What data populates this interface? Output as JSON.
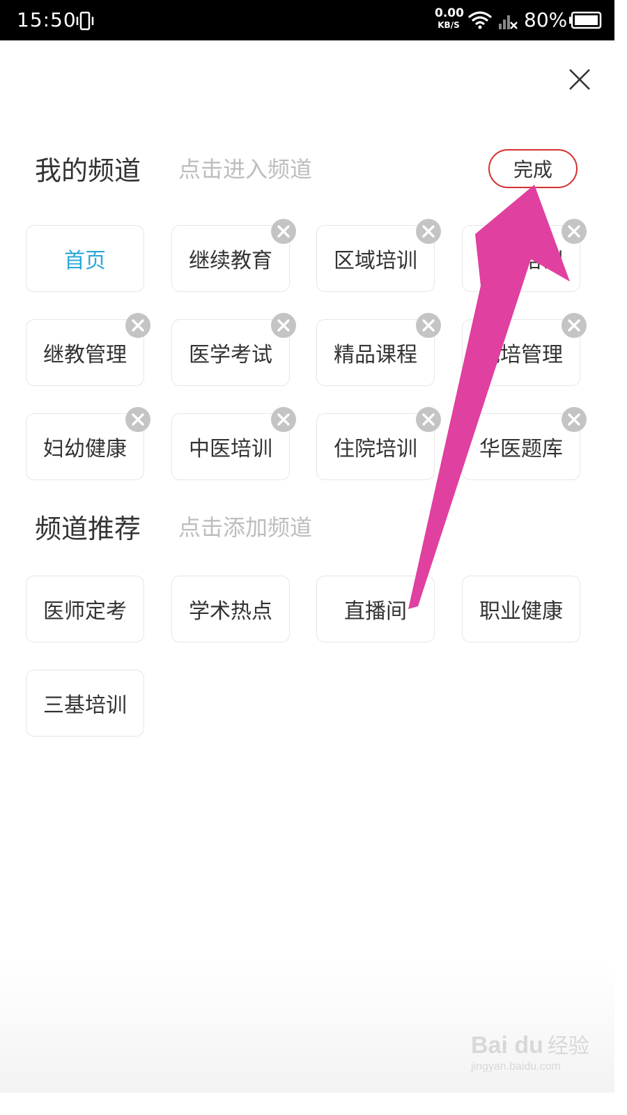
{
  "status_bar": {
    "time": "15:50",
    "net_speed_value": "0.00",
    "net_speed_unit": "KB/S",
    "battery_percent": "80%"
  },
  "my_channels": {
    "title": "我的频道",
    "hint": "点击进入频道",
    "done_label": "完成",
    "items": [
      {
        "label": "首页",
        "active": true,
        "removable": false
      },
      {
        "label": "继续教育",
        "active": false,
        "removable": true
      },
      {
        "label": "区域培训",
        "active": false,
        "removable": true
      },
      {
        "label": "基层培训",
        "active": false,
        "removable": true
      },
      {
        "label": "继教管理",
        "active": false,
        "removable": true
      },
      {
        "label": "医学考试",
        "active": false,
        "removable": true
      },
      {
        "label": "精品课程",
        "active": false,
        "removable": true
      },
      {
        "label": "规培管理",
        "active": false,
        "removable": true
      },
      {
        "label": "妇幼健康",
        "active": false,
        "removable": true
      },
      {
        "label": "中医培训",
        "active": false,
        "removable": true
      },
      {
        "label": "住院培训",
        "active": false,
        "removable": true
      },
      {
        "label": "华医题库",
        "active": false,
        "removable": true
      }
    ]
  },
  "recommended_channels": {
    "title": "频道推荐",
    "hint": "点击添加频道",
    "items": [
      {
        "label": "医师定考"
      },
      {
        "label": "学术热点"
      },
      {
        "label": "直播间"
      },
      {
        "label": "职业健康"
      },
      {
        "label": "三基培训"
      }
    ]
  },
  "watermark": {
    "logo": "Bai du",
    "brand": "经验",
    "url": "jingyan.baidu.com"
  },
  "colors": {
    "active_channel": "#29a8d6",
    "done_border": "#d32f2f",
    "annotation_arrow": "#e040a0"
  }
}
